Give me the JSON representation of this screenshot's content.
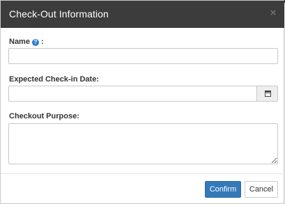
{
  "dialog": {
    "title": "Check-Out Information",
    "close_glyph": "×"
  },
  "form": {
    "name_label": "Name",
    "name_suffix": " :",
    "name_help_icon": "question-circle-icon",
    "name_value": "",
    "date_label": "Expected Check-in Date:",
    "date_value": "",
    "date_icon": "calendar-icon",
    "purpose_label": "Checkout Purpose:",
    "purpose_value": ""
  },
  "footer": {
    "confirm_label": "Confirm",
    "cancel_label": "Cancel"
  },
  "colors": {
    "header_bg": "#3c3c3c",
    "primary": "#337ab7",
    "help_icon": "#2f7ecb"
  }
}
